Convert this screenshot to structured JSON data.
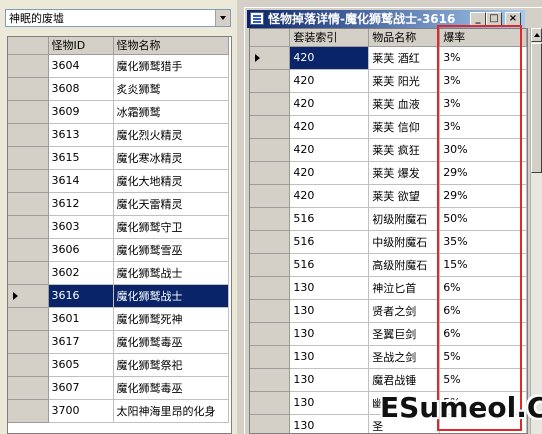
{
  "left_panel": {
    "map_combo": {
      "value": "神眠的废墟"
    },
    "monster_grid": {
      "columns": [
        "怪物ID",
        "怪物名称"
      ],
      "rows": [
        {
          "id": "3604",
          "name": "魔化狮鹫猎手"
        },
        {
          "id": "3608",
          "name": "炙炎狮鹫"
        },
        {
          "id": "3609",
          "name": "冰霜狮鹫"
        },
        {
          "id": "3613",
          "name": "魔化烈火精灵"
        },
        {
          "id": "3615",
          "name": "魔化寒冰精灵"
        },
        {
          "id": "3614",
          "name": "魔化大地精灵"
        },
        {
          "id": "3612",
          "name": "魔化天雷精灵"
        },
        {
          "id": "3603",
          "name": "魔化狮鹫守卫"
        },
        {
          "id": "3606",
          "name": "魔化狮鹫雪巫"
        },
        {
          "id": "3602",
          "name": "魔化狮鹫战士"
        },
        {
          "id": "3616",
          "name": "魔化狮鹫战士"
        },
        {
          "id": "3601",
          "name": "魔化狮鹫死神"
        },
        {
          "id": "3617",
          "name": "魔化狮鹫毒巫"
        },
        {
          "id": "3605",
          "name": "魔化狮鹫祭祀"
        },
        {
          "id": "3607",
          "name": "魔化狮鹫毒巫"
        },
        {
          "id": "3700",
          "name": "太阳神海里昂的化身"
        }
      ],
      "selected_index": 10
    }
  },
  "drop_window": {
    "title": "怪物掉落详情-魔化狮鹫战士-3616",
    "buttons": {
      "minimize": "_",
      "maximize": "□",
      "close": "×"
    },
    "drop_grid": {
      "columns": [
        "套装索引",
        "物品名称",
        "爆率"
      ],
      "rows": [
        {
          "index": "420",
          "item": "莱芙 酒红",
          "rate": "3%"
        },
        {
          "index": "420",
          "item": "莱芙 阳光",
          "rate": "3%"
        },
        {
          "index": "420",
          "item": "莱芙 血液",
          "rate": "3%"
        },
        {
          "index": "420",
          "item": "莱芙 信仰",
          "rate": "3%"
        },
        {
          "index": "420",
          "item": "莱芙 疯狂",
          "rate": "30%"
        },
        {
          "index": "420",
          "item": "莱芙 爆发",
          "rate": "29%"
        },
        {
          "index": "420",
          "item": "莱芙 欲望",
          "rate": "29%"
        },
        {
          "index": "516",
          "item": "初级附魔石",
          "rate": "50%"
        },
        {
          "index": "516",
          "item": "中级附魔石",
          "rate": "35%"
        },
        {
          "index": "516",
          "item": "高级附魔石",
          "rate": "15%"
        },
        {
          "index": "130",
          "item": "神泣匕首",
          "rate": "6%"
        },
        {
          "index": "130",
          "item": "贤者之剑",
          "rate": "6%"
        },
        {
          "index": "130",
          "item": "圣翼巨剑",
          "rate": "6%"
        },
        {
          "index": "130",
          "item": "圣战之剑",
          "rate": "5%"
        },
        {
          "index": "130",
          "item": "魔君战锤",
          "rate": "5%"
        },
        {
          "index": "130",
          "item": "幽冥",
          "rate": "5%"
        },
        {
          "index": "130",
          "item": "圣",
          "rate": ""
        }
      ],
      "selected_index": 0
    }
  },
  "watermark": {
    "text": "ESumeol.Cn"
  },
  "colors": {
    "selection": "#0a246a",
    "highlight_box": "#e02828",
    "title_gradient_start": "#0a246a",
    "title_gradient_end": "#a6caf0"
  }
}
